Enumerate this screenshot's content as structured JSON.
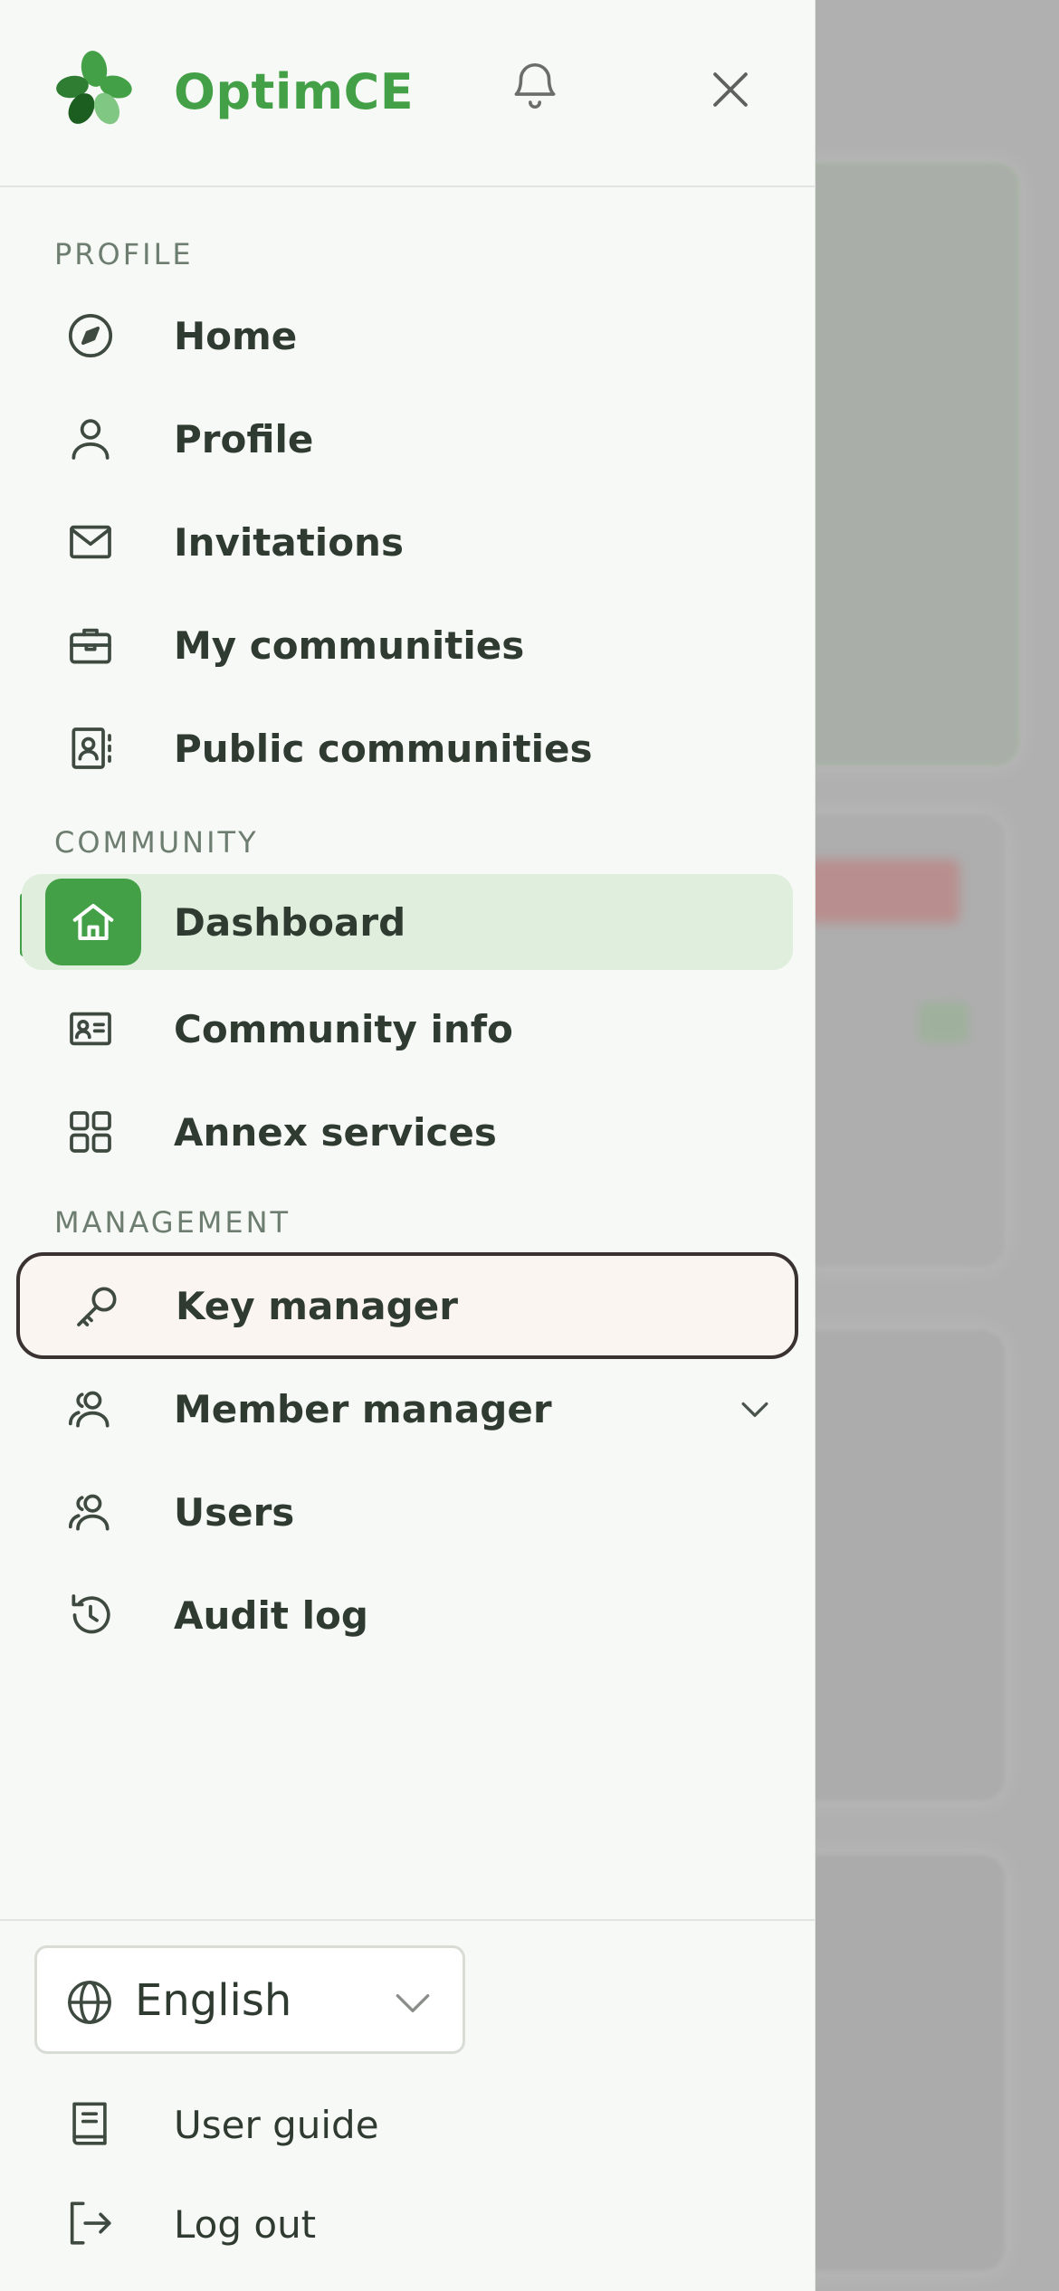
{
  "app": {
    "name": "OptimCE"
  },
  "sections": {
    "profile": "PROFILE",
    "community": "COMMUNITY",
    "management": "MANAGEMENT"
  },
  "profile_items": [
    {
      "label": "Home",
      "icon": "compass-icon"
    },
    {
      "label": "Profile",
      "icon": "user-icon"
    },
    {
      "label": "Invitations",
      "icon": "mail-icon"
    },
    {
      "label": "My communities",
      "icon": "briefcase-icon"
    },
    {
      "label": "Public communities",
      "icon": "contacts-book-icon"
    }
  ],
  "community_items": [
    {
      "label": "Dashboard",
      "icon": "home-icon",
      "active": true
    },
    {
      "label": "Community info",
      "icon": "id-card-icon"
    },
    {
      "label": "Annex services",
      "icon": "grid-icon"
    }
  ],
  "management_items": [
    {
      "label": "Key manager",
      "icon": "key-icon",
      "focused": true
    },
    {
      "label": "Member manager",
      "icon": "users-icon",
      "expandable": true
    },
    {
      "label": "Users",
      "icon": "users-icon"
    },
    {
      "label": "Audit log",
      "icon": "history-icon"
    }
  ],
  "language": {
    "selected": "English"
  },
  "footer": {
    "user_guide": "User guide",
    "logout": "Log out"
  },
  "colors": {
    "brand": "#43a047",
    "drawer_bg": "#f7f9f6",
    "active_bg": "#dfeedd",
    "text": "#2f3b31"
  }
}
